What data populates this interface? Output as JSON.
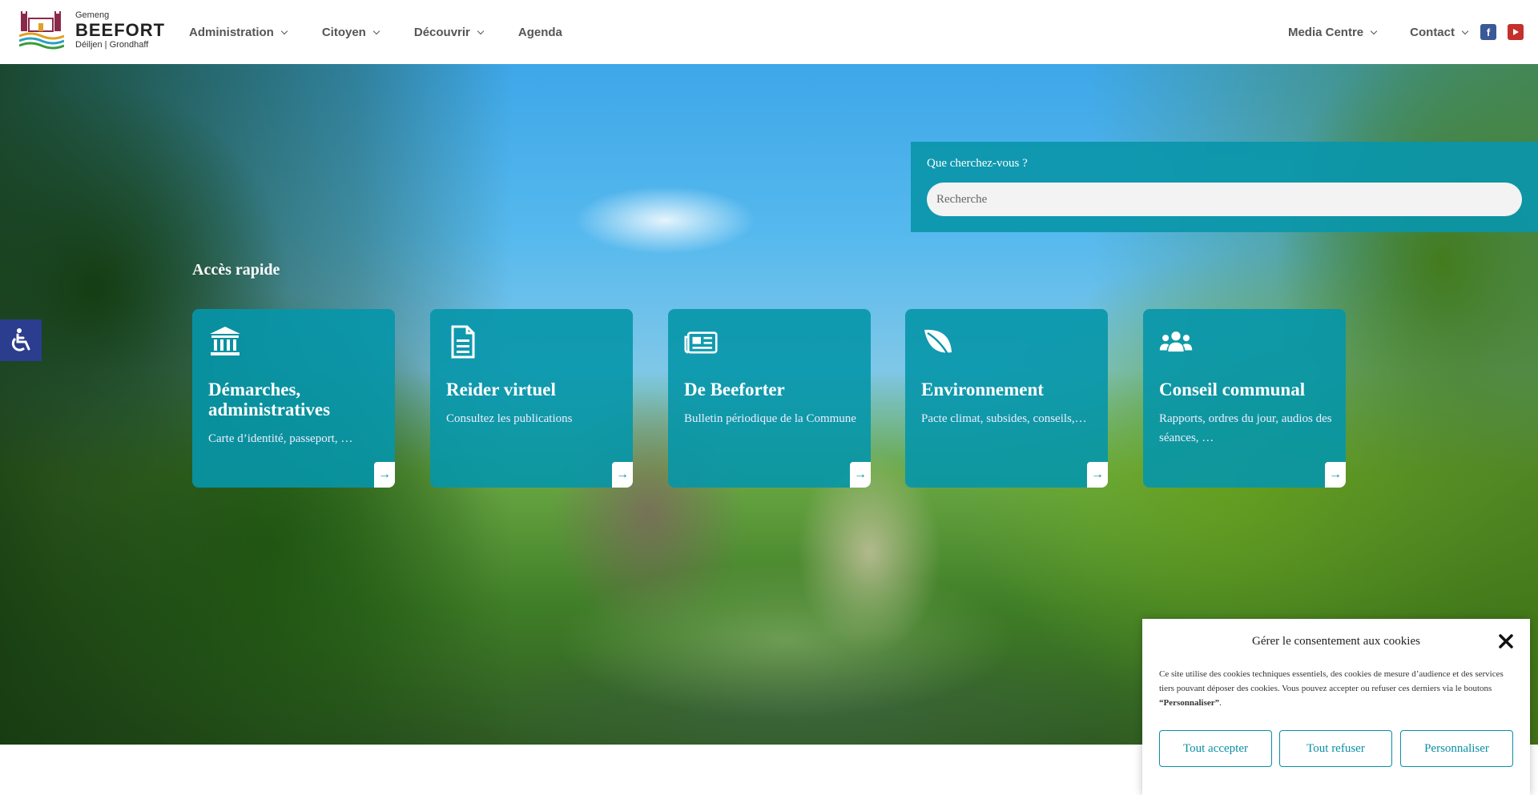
{
  "header": {
    "logo": {
      "top": "Gemeng",
      "name": "BEEFORT",
      "sub": "Déiljen | Grondhaff"
    },
    "nav_left": [
      {
        "label": "Administration",
        "dropdown": true
      },
      {
        "label": "Citoyen",
        "dropdown": true
      },
      {
        "label": "Découvrir",
        "dropdown": true
      },
      {
        "label": "Agenda",
        "dropdown": false
      }
    ],
    "nav_right": [
      {
        "label": "Media Centre",
        "dropdown": true
      },
      {
        "label": "Contact",
        "dropdown": true
      }
    ],
    "social": [
      {
        "icon": "facebook-icon",
        "color": "#3b5998"
      },
      {
        "icon": "youtube-icon",
        "color": "#c4302b"
      }
    ]
  },
  "search": {
    "label": "Que cherchez-vous ?",
    "placeholder": "Recherche"
  },
  "quick_access": {
    "title": "Accès rapide",
    "cards": [
      {
        "icon": "institution-icon",
        "title": "Démarches, administratives",
        "desc": "Carte d’identité, passeport, …"
      },
      {
        "icon": "document-icon",
        "title": "Reider virtuel",
        "desc": "Consultez les publications"
      },
      {
        "icon": "newspaper-icon",
        "title": "De Beeforter",
        "desc": "Bulletin périodique de la Commune"
      },
      {
        "icon": "leaf-icon",
        "title": "Environnement",
        "desc": "Pacte climat, subsides, conseils,…"
      },
      {
        "icon": "users-icon",
        "title": "Conseil communal",
        "desc": "Rapports, ordres du jour, audios des séances, …"
      }
    ]
  },
  "cookie": {
    "title": "Gérer le consentement aux cookies",
    "text_before": "Ce site utilise des cookies techniques essentiels, des cookies de mesure d’audience et des services tiers pouvant déposer des cookies. Vous pouvez accepter ou refuser ces derniers via le boutons ",
    "text_bold": "“Personnaliser”",
    "text_after": ".",
    "buttons": {
      "accept": "Tout accepter",
      "refuse": "Tout refuser",
      "customize": "Personnaliser"
    }
  },
  "colors": {
    "accent": "#0a96aa",
    "accessibility": "#2a3d8f"
  }
}
